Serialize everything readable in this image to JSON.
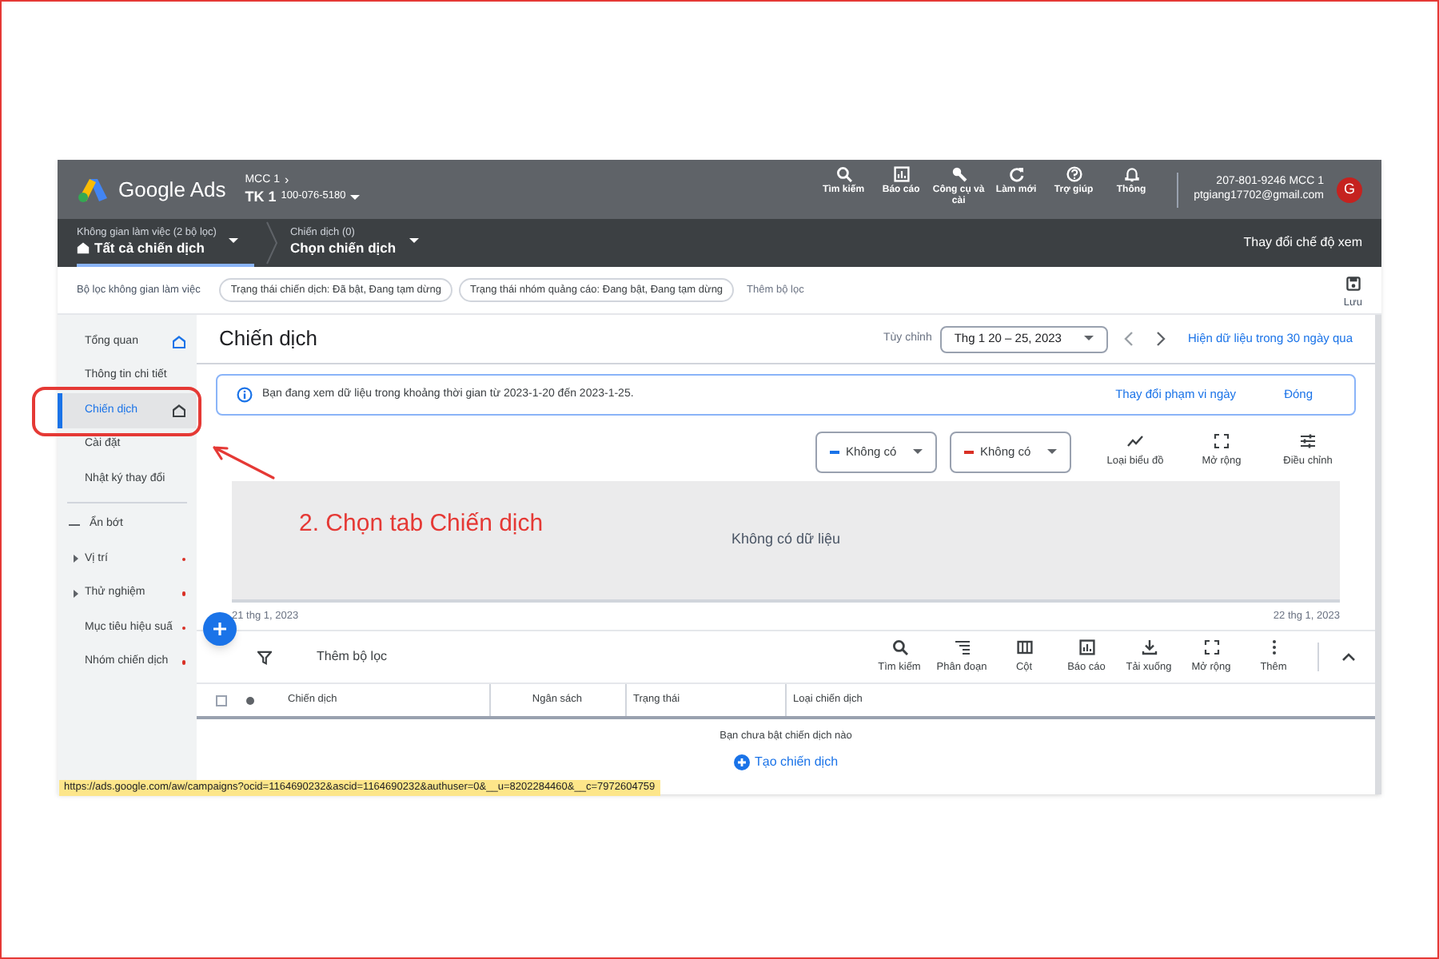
{
  "top_bar": {
    "logo": "Google Ads",
    "account": {
      "manager": "MCC 1",
      "chevron": "›",
      "name": "TK 1",
      "id": "100-076-5180"
    },
    "nav": [
      {
        "kind": "search",
        "label": "Tìm kiếm"
      },
      {
        "kind": "report",
        "label": "Báo cáo"
      },
      {
        "kind": "tools",
        "label": "Công cụ và cài"
      },
      {
        "kind": "refresh",
        "label": "Làm mới"
      },
      {
        "kind": "help",
        "label": "Trợ giúp"
      },
      {
        "kind": "bell",
        "label": "Thông"
      }
    ],
    "user": {
      "account_line": "207-801-9246 MCC 1",
      "email": "ptgiang17702@gmail.com",
      "avatar": "G"
    }
  },
  "breadcrumb": [
    {
      "caption": "Không gian làm việc (2 bộ lọc)",
      "value": "Tất cả chiến dịch",
      "selected": true
    },
    {
      "caption": "Chiến dịch (0)",
      "value": "Chọn chiến dịch",
      "selected": false
    }
  ],
  "view_mode": "Thay đổi chế độ xem",
  "filter_bar": {
    "label": "Bộ lọc không gian làm việc",
    "chips": [
      "Trạng thái chiến dịch: Đã bật, Đang tạm dừng",
      "Trạng thái nhóm quảng cáo: Đang bật, Đang tạm dừng"
    ],
    "add": "Thêm bộ lọc",
    "save": "Lưu"
  },
  "sidebar": {
    "items": [
      {
        "kind": "home",
        "label": "Tổng quan",
        "selected": false
      },
      {
        "kind": "plain",
        "label": "Thông tin chi tiết",
        "selected": false
      },
      {
        "kind": "home",
        "label": "Chiến dịch",
        "selected": true
      },
      {
        "kind": "plain",
        "label": "Cài đặt",
        "selected": false
      },
      {
        "kind": "plain",
        "label": "Nhật ký thay đổi",
        "selected": false
      },
      {
        "kind": "collapse",
        "label": "Ẩn bớt",
        "selected": false
      },
      {
        "kind": "group",
        "label": "Vị trí",
        "selected": false
      },
      {
        "kind": "group",
        "label": "Thử nghiệm",
        "selected": false
      },
      {
        "kind": "dot",
        "label": "Mục tiêu hiệu suấ",
        "selected": false
      },
      {
        "kind": "dot",
        "label": "Nhóm chiến dịch",
        "selected": false
      }
    ]
  },
  "page": {
    "title": "Chiến dịch",
    "date_preset": "Tùy chỉnh",
    "date_range": "Thg 1 20 – 25, 2023",
    "recent_link": "Hiện dữ liệu trong 30 ngày qua"
  },
  "banner": {
    "text": "Bạn đang xem dữ liệu trong khoảng thời gian từ 2023-1-20 đến 2023-1-25.",
    "actions": [
      "Thay đổi phạm vi ngày",
      "Đóng"
    ]
  },
  "chart": {
    "metrics": [
      {
        "label": "Không có",
        "color": "#1a73e8"
      },
      {
        "label": "Không có",
        "color": "#d93025"
      }
    ],
    "tools": [
      {
        "kind": "linechart",
        "label": "Loại biểu đồ"
      },
      {
        "kind": "expand",
        "label": "Mở rộng"
      },
      {
        "kind": "tune",
        "label": "Điều chỉnh"
      }
    ],
    "empty": "Không có dữ liệu",
    "start": "21 thg 1, 2023",
    "end": "22 thg 1, 2023"
  },
  "table": {
    "filter": "Thêm bộ lọc",
    "select_all_checked": false,
    "tools": [
      {
        "kind": "search",
        "label": "Tìm kiếm"
      },
      {
        "kind": "segment",
        "label": "Phân đoạn"
      },
      {
        "kind": "columns",
        "label": "Cột"
      },
      {
        "kind": "report",
        "label": "Báo cáo"
      },
      {
        "kind": "download",
        "label": "Tải xuống"
      },
      {
        "kind": "expand",
        "label": "Mở rộng"
      },
      {
        "kind": "more",
        "label": "Thêm"
      }
    ],
    "columns": [
      "Chiến dịch",
      "Ngân sách",
      "Trạng thái",
      "Loại chiến dịch"
    ],
    "empty": "Bạn chưa bật chiến dịch nào",
    "create": "Tạo chiến dịch"
  },
  "status_url": "https://ads.google.com/aw/campaigns?ocid=1164690232&ascid=1164690232&authuser=0&__u=8202284460&__c=7972604759",
  "annotation": {
    "text": "2. Chọn tab Chiến dịch"
  }
}
